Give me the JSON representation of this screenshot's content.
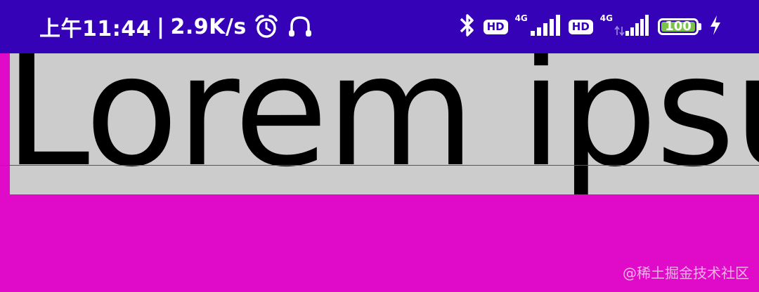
{
  "status_bar": {
    "time": "上午11:44",
    "separator": "|",
    "net_speed": "2.9K/s",
    "hd_badge_1": "HD",
    "net_type_1": "4G",
    "hd_badge_2": "HD",
    "net_type_2": "4G",
    "battery_level": "100",
    "icons": [
      "alarm-clock-icon",
      "headphone-icon",
      "bluetooth-icon",
      "signal-bars-icon",
      "charging-bolt-icon"
    ],
    "background": "#3502b8"
  },
  "content": {
    "text": "Lorem ipsum",
    "textview_background": "#cccccc",
    "page_background": "#e00bc8"
  },
  "watermark": "@稀土掘金技术社区"
}
